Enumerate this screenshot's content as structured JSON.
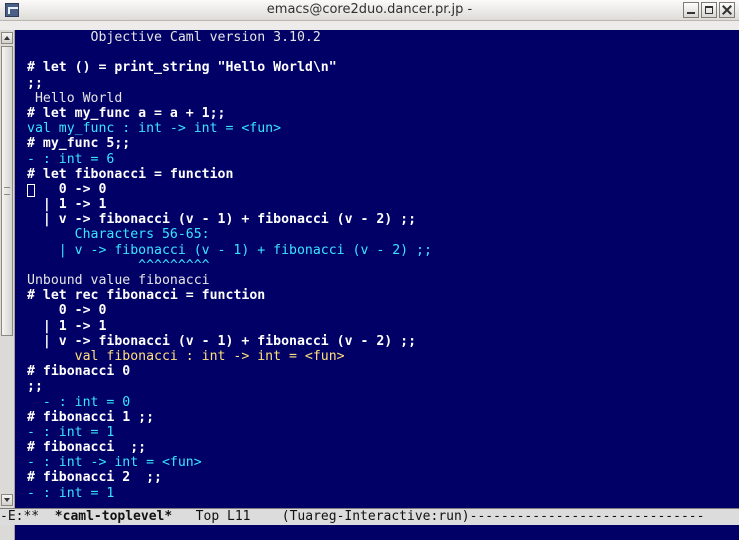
{
  "window": {
    "title": "emacs@core2duo.dancer.pr.jp -",
    "buttons": [
      "minimize",
      "maximize",
      "close"
    ]
  },
  "buffer": {
    "lines": [
      {
        "parts": [
          {
            "t": "        Objective Caml version 3.10.2",
            "c": "c-banner"
          }
        ]
      },
      {
        "parts": [
          {
            "t": "",
            "c": "c-banner"
          }
        ]
      },
      {
        "parts": [
          {
            "t": "# ",
            "c": "c-prompt"
          },
          {
            "t": "let () = print_string \"Hello World\\n\"",
            "c": "c-input"
          }
        ]
      },
      {
        "parts": [
          {
            "t": ";;",
            "c": "c-input"
          }
        ]
      },
      {
        "parts": [
          {
            "t": " Hello World",
            "c": "c-output"
          }
        ]
      },
      {
        "parts": [
          {
            "t": "# ",
            "c": "c-prompt"
          },
          {
            "t": "let my_func a = a + 1;;",
            "c": "c-input"
          }
        ]
      },
      {
        "parts": [
          {
            "t": "val my_func : int -> int = <fun>",
            "c": "c-response"
          }
        ]
      },
      {
        "parts": [
          {
            "t": "# ",
            "c": "c-prompt"
          },
          {
            "t": "my_func 5;;",
            "c": "c-input"
          }
        ]
      },
      {
        "parts": [
          {
            "t": "- : int = 6",
            "c": "c-response"
          }
        ]
      },
      {
        "parts": [
          {
            "t": "# ",
            "c": "c-prompt"
          },
          {
            "t": "let fibonacci = function",
            "c": "c-input"
          }
        ]
      },
      {
        "parts": [
          {
            "t": "    0 -> 0",
            "c": "c-input"
          }
        ]
      },
      {
        "parts": [
          {
            "t": "  | 1 -> 1",
            "c": "c-input"
          }
        ]
      },
      {
        "parts": [
          {
            "t": "  | v -> fibonacci (v - 1) + fibonacci (v - 2) ;;",
            "c": "c-input"
          }
        ]
      },
      {
        "parts": [
          {
            "t": "      Characters 56-65:",
            "c": "c-loc"
          }
        ]
      },
      {
        "parts": [
          {
            "t": "    | v -> fibonacci (v - 1) + fibonacci (v - 2) ;;",
            "c": "c-loc"
          }
        ]
      },
      {
        "parts": [
          {
            "t": "              ^^^^^^^^^",
            "c": "c-caret"
          }
        ]
      },
      {
        "parts": [
          {
            "t": "Unbound value fibonacci",
            "c": "c-error"
          }
        ]
      },
      {
        "parts": [
          {
            "t": "# ",
            "c": "c-prompt"
          },
          {
            "t": "let rec fibonacci = function",
            "c": "c-input"
          }
        ]
      },
      {
        "parts": [
          {
            "t": "    0 -> 0",
            "c": "c-input"
          }
        ]
      },
      {
        "parts": [
          {
            "t": "  | 1 -> 1",
            "c": "c-input"
          }
        ]
      },
      {
        "parts": [
          {
            "t": "  | v -> fibonacci (v - 1) + fibonacci (v - 2) ;;",
            "c": "c-input"
          }
        ]
      },
      {
        "parts": [
          {
            "t": "      val fibonacci : int -> int = <fun>",
            "c": "c-yellow"
          }
        ]
      },
      {
        "parts": [
          {
            "t": "# ",
            "c": "c-prompt"
          },
          {
            "t": "fibonacci 0",
            "c": "c-input"
          }
        ]
      },
      {
        "parts": [
          {
            "t": ";;",
            "c": "c-input"
          }
        ]
      },
      {
        "parts": [
          {
            "t": "  - : int = 0",
            "c": "c-response"
          }
        ]
      },
      {
        "parts": [
          {
            "t": "# ",
            "c": "c-prompt"
          },
          {
            "t": "fibonacci 1 ;;",
            "c": "c-input"
          }
        ]
      },
      {
        "parts": [
          {
            "t": "- : int = 1",
            "c": "c-response"
          }
        ]
      },
      {
        "parts": [
          {
            "t": "# ",
            "c": "c-prompt"
          },
          {
            "t": "fibonacci  ;;",
            "c": "c-input"
          }
        ]
      },
      {
        "parts": [
          {
            "t": "- : int -> int = <fun>",
            "c": "c-response"
          }
        ]
      },
      {
        "parts": [
          {
            "t": "# ",
            "c": "c-prompt"
          },
          {
            "t": "fibonacci 2  ;;",
            "c": "c-input"
          }
        ]
      },
      {
        "parts": [
          {
            "t": "- : int = 1",
            "c": "c-response"
          }
        ]
      }
    ]
  },
  "modeline": {
    "status": "-E:** ",
    "buffer_name": " *caml-toplevel*",
    "position": "   Top L11    ",
    "mode": "(Tuareg-Interactive:run)",
    "filler": "------------------------------"
  },
  "colors": {
    "background": "#000066",
    "input": "#ffffff",
    "response": "#39e6ff",
    "highlight": "#ffe07a"
  }
}
